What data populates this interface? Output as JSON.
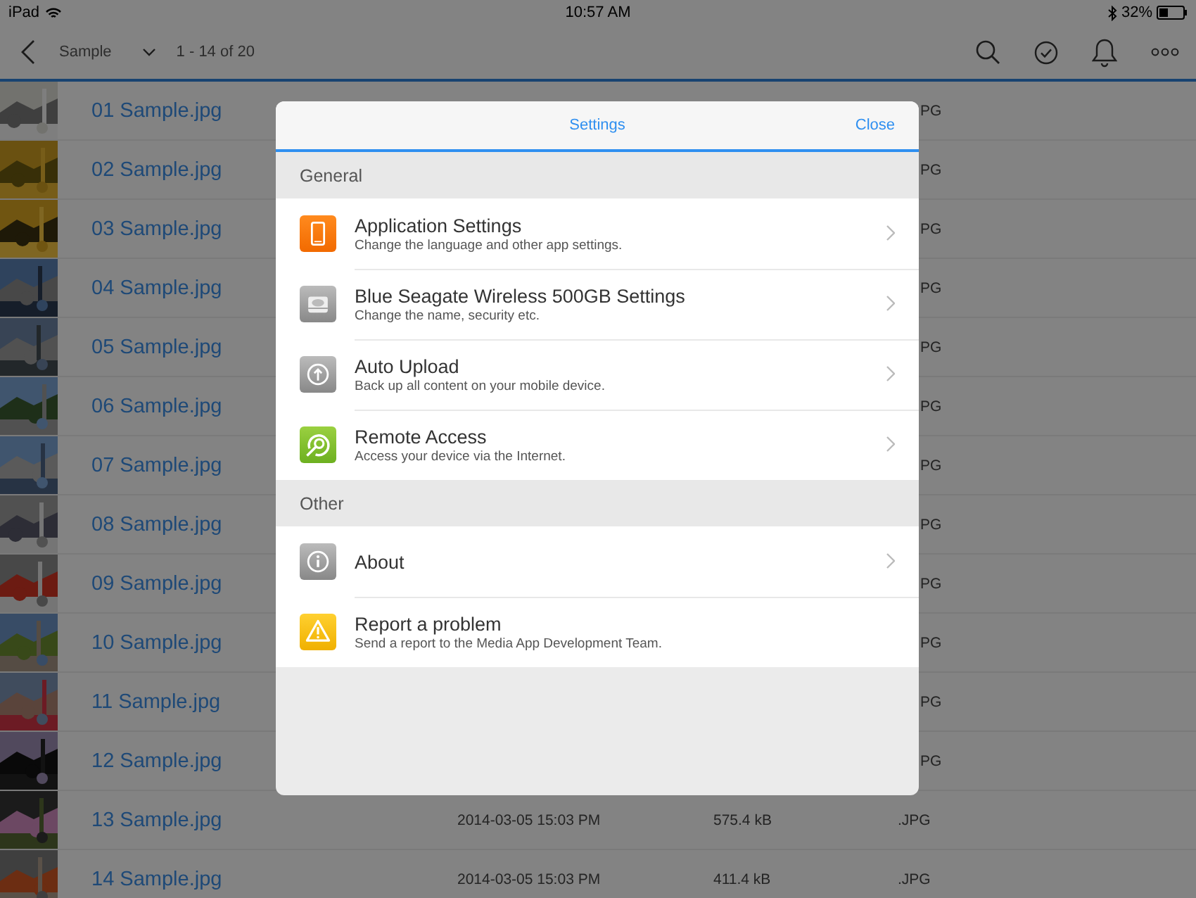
{
  "status_bar": {
    "device": "iPad",
    "time": "10:57 AM",
    "battery": "32%"
  },
  "toolbar": {
    "folder": "Sample",
    "range": "1 - 14 of 20"
  },
  "files": [
    {
      "name": "01 Sample.jpg",
      "ext": "PG"
    },
    {
      "name": "02 Sample.jpg",
      "ext": "PG"
    },
    {
      "name": "03 Sample.jpg",
      "ext": "PG"
    },
    {
      "name": "04 Sample.jpg",
      "ext": "PG"
    },
    {
      "name": "05 Sample.jpg",
      "ext": "PG"
    },
    {
      "name": "06 Sample.jpg",
      "ext": "PG"
    },
    {
      "name": "07 Sample.jpg",
      "ext": "PG"
    },
    {
      "name": "08 Sample.jpg",
      "ext": "PG"
    },
    {
      "name": "09 Sample.jpg",
      "ext": "PG"
    },
    {
      "name": "10 Sample.jpg",
      "ext": "PG"
    },
    {
      "name": "11 Sample.jpg",
      "ext": "PG"
    },
    {
      "name": "12 Sample.jpg",
      "ext": "PG"
    },
    {
      "name": "13 Sample.jpg",
      "date": "2014-03-05 15:03 PM",
      "size": "575.4 kB",
      "ext": ".JPG"
    },
    {
      "name": "14 Sample.jpg",
      "date": "2014-03-05 15:03 PM",
      "size": "411.4 kB",
      "ext": ".JPG"
    }
  ],
  "dialog": {
    "title": "Settings",
    "close": "Close",
    "sections": [
      {
        "title": "General",
        "items": [
          {
            "title": "Application Settings",
            "subtitle": "Change the language and other app settings.",
            "has_chevron": true
          },
          {
            "title": "Blue Seagate Wireless 500GB Settings",
            "subtitle": "Change the name, security etc.",
            "has_chevron": true
          },
          {
            "title": "Auto Upload",
            "subtitle": "Back up all content on your mobile device.",
            "has_chevron": true
          },
          {
            "title": "Remote Access",
            "subtitle": "Access your device via the Internet.",
            "has_chevron": true
          }
        ]
      },
      {
        "title": "Other",
        "items": [
          {
            "title": "About",
            "has_chevron": true
          },
          {
            "title": "Report a problem",
            "subtitle": "Send a report to the Media App Development Team.",
            "has_chevron": false
          }
        ]
      }
    ]
  }
}
